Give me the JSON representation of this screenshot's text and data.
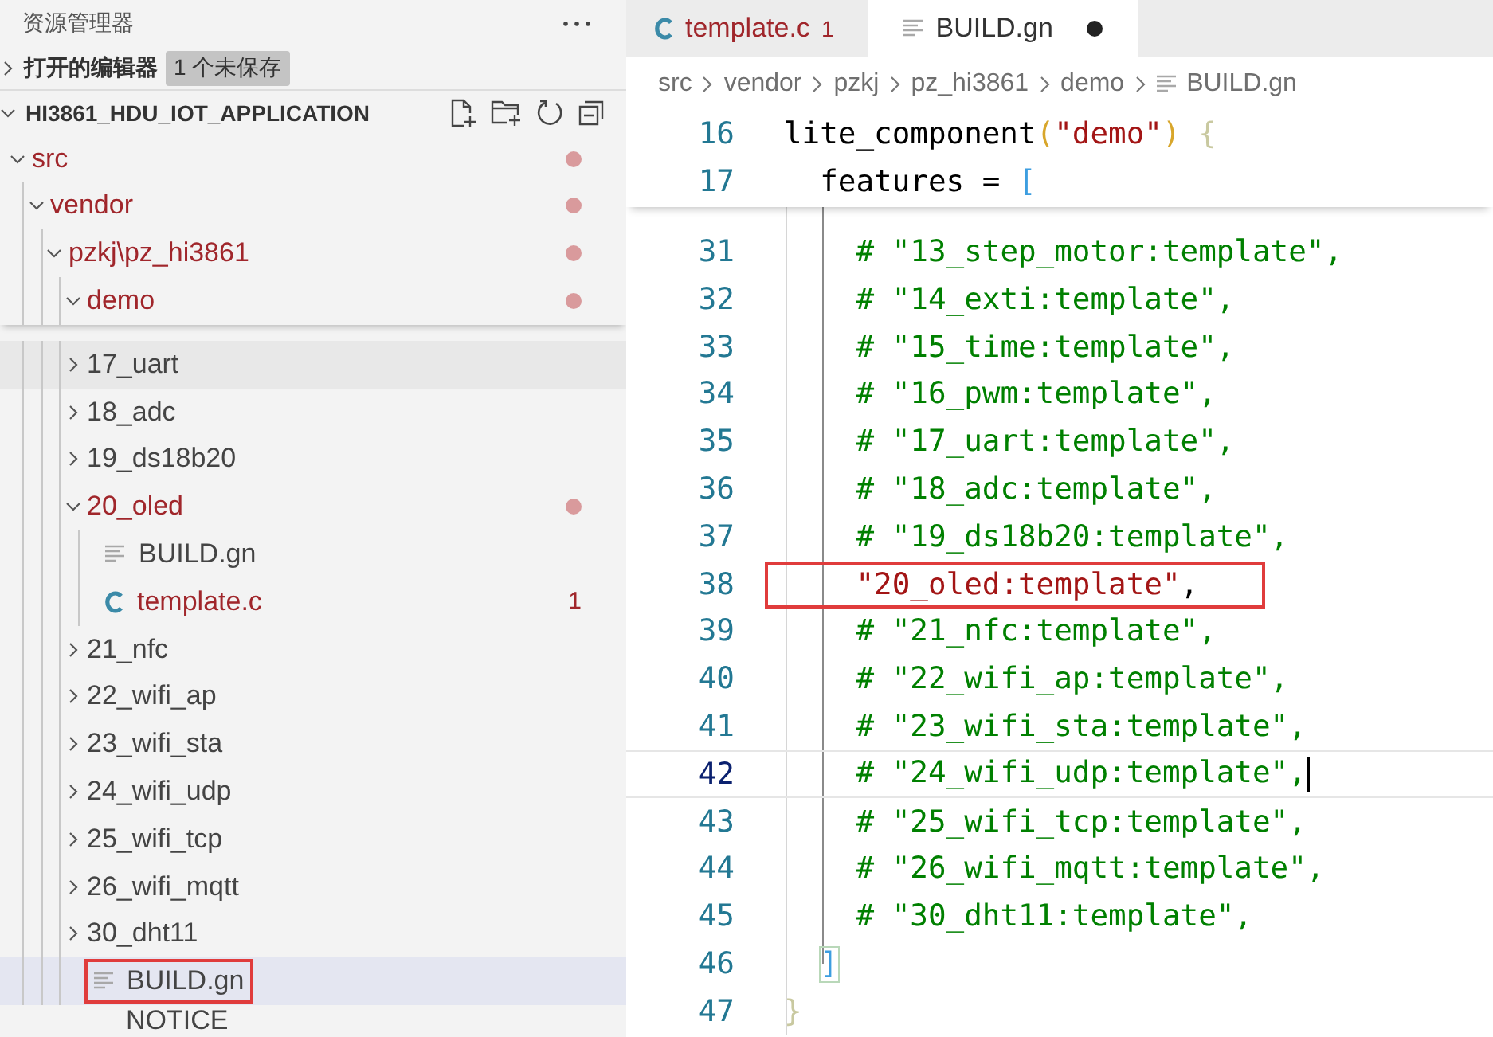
{
  "sidebar": {
    "title": "资源管理器",
    "open_editors": {
      "label": "打开的编辑器",
      "badge": "1 个未保存",
      "expanded": false
    },
    "project": {
      "name": "HI3861_HDU_IOT_APPLICATION",
      "expanded": true
    },
    "sticky": [
      {
        "name": "src",
        "kind": "folder",
        "expanded": true,
        "modified": true,
        "children": [
          {
            "name": "vendor",
            "kind": "folder",
            "expanded": true,
            "modified": true,
            "children": [
              {
                "name": "pzkj\\pz_hi3861",
                "kind": "folder",
                "expanded": true,
                "modified": true,
                "children": [
                  {
                    "name": "demo",
                    "kind": "folder",
                    "expanded": true,
                    "modified": true
                  }
                ]
              }
            ]
          }
        ]
      }
    ],
    "items": [
      {
        "name": "17_uart",
        "kind": "folder",
        "expanded": false,
        "modified": false,
        "hovered": true
      },
      {
        "name": "18_adc",
        "kind": "folder",
        "expanded": false,
        "modified": false
      },
      {
        "name": "19_ds18b20",
        "kind": "folder",
        "expanded": false,
        "modified": false
      },
      {
        "name": "20_oled",
        "kind": "folder",
        "expanded": true,
        "modified": true,
        "children": [
          {
            "name": "BUILD.gn",
            "kind": "text",
            "modified": false
          },
          {
            "name": "template.c",
            "kind": "c",
            "modified": true,
            "badge": "1"
          }
        ]
      },
      {
        "name": "21_nfc",
        "kind": "folder",
        "expanded": false,
        "modified": false
      },
      {
        "name": "22_wifi_ap",
        "kind": "folder",
        "expanded": false,
        "modified": false
      },
      {
        "name": "23_wifi_sta",
        "kind": "folder",
        "expanded": false,
        "modified": false
      },
      {
        "name": "24_wifi_udp",
        "kind": "folder",
        "expanded": false,
        "modified": false
      },
      {
        "name": "25_wifi_tcp",
        "kind": "folder",
        "expanded": false,
        "modified": false
      },
      {
        "name": "26_wifi_mqtt",
        "kind": "folder",
        "expanded": false,
        "modified": false
      },
      {
        "name": "30_dht11",
        "kind": "folder",
        "expanded": false,
        "modified": false
      },
      {
        "name": "BUILD.gn",
        "kind": "text",
        "modified": false,
        "selected": true,
        "highlighted": true
      }
    ],
    "footer": "NOTICE"
  },
  "editor": {
    "tabs": [
      {
        "label": "template.c",
        "kind": "c",
        "badge": "1",
        "dirty": false,
        "selected": false
      },
      {
        "label": "BUILD.gn",
        "kind": "text",
        "dirty": true,
        "selected": true
      }
    ],
    "breadcrumb": [
      {
        "label": "src",
        "kind": "folder"
      },
      {
        "label": "vendor",
        "kind": "folder"
      },
      {
        "label": "pzkj",
        "kind": "folder"
      },
      {
        "label": "pz_hi3861",
        "kind": "folder"
      },
      {
        "label": "demo",
        "kind": "folder"
      },
      {
        "label": "BUILD.gn",
        "kind": "text"
      }
    ],
    "sticky_lines": [
      {
        "number": "16",
        "tokens": [
          {
            "text": "lite_component",
            "kind": "plain"
          },
          {
            "text": "(",
            "kind": "paren"
          },
          {
            "text": "\"demo\"",
            "kind": "string"
          },
          {
            "text": ")",
            "kind": "paren"
          },
          {
            "text": " {",
            "kind": "brace"
          }
        ]
      },
      {
        "number": "17",
        "tokens": [
          {
            "text": "  features = ",
            "kind": "plain"
          },
          {
            "text": "[",
            "kind": "bracket"
          }
        ]
      }
    ],
    "lines": [
      {
        "number": "31",
        "tokens": [
          {
            "text": "    # \"13_step_motor:template\",",
            "kind": "comment"
          }
        ]
      },
      {
        "number": "32",
        "tokens": [
          {
            "text": "    # \"14_exti:template\",",
            "kind": "comment"
          }
        ]
      },
      {
        "number": "33",
        "tokens": [
          {
            "text": "    # \"15_time:template\",",
            "kind": "comment"
          }
        ]
      },
      {
        "number": "34",
        "tokens": [
          {
            "text": "    # \"16_pwm:template\",",
            "kind": "comment"
          }
        ]
      },
      {
        "number": "35",
        "tokens": [
          {
            "text": "    # \"17_uart:template\",",
            "kind": "comment"
          }
        ]
      },
      {
        "number": "36",
        "tokens": [
          {
            "text": "    # \"18_adc:template\",",
            "kind": "comment"
          }
        ]
      },
      {
        "number": "37",
        "tokens": [
          {
            "text": "    # \"19_ds18b20:template\",",
            "kind": "comment"
          }
        ]
      },
      {
        "number": "38",
        "boxed": true,
        "tokens": [
          {
            "text": "    \"20_oled:template\"",
            "kind": "string"
          },
          {
            "text": ",",
            "kind": "plain"
          }
        ]
      },
      {
        "number": "39",
        "tokens": [
          {
            "text": "    # \"21_nfc:template\",",
            "kind": "comment"
          }
        ]
      },
      {
        "number": "40",
        "tokens": [
          {
            "text": "    # \"22_wifi_ap:template\",",
            "kind": "comment"
          }
        ]
      },
      {
        "number": "41",
        "tokens": [
          {
            "text": "    # \"23_wifi_sta:template\",",
            "kind": "comment"
          }
        ]
      },
      {
        "number": "42",
        "current": true,
        "tokens": [
          {
            "text": "    # \"24_wifi_udp:template\",",
            "kind": "comment"
          }
        ]
      },
      {
        "number": "43",
        "tokens": [
          {
            "text": "    # \"25_wifi_tcp:template\",",
            "kind": "comment"
          }
        ]
      },
      {
        "number": "44",
        "tokens": [
          {
            "text": "    # \"26_wifi_mqtt:template\",",
            "kind": "comment"
          }
        ]
      },
      {
        "number": "45",
        "tokens": [
          {
            "text": "    # \"30_dht11:template\",",
            "kind": "comment"
          }
        ]
      },
      {
        "number": "46",
        "tokens": [
          {
            "text": "  ]",
            "kind": "bracket-match"
          }
        ]
      },
      {
        "number": "47",
        "tokens": [
          {
            "text": "}",
            "kind": "brace"
          }
        ]
      }
    ]
  }
}
